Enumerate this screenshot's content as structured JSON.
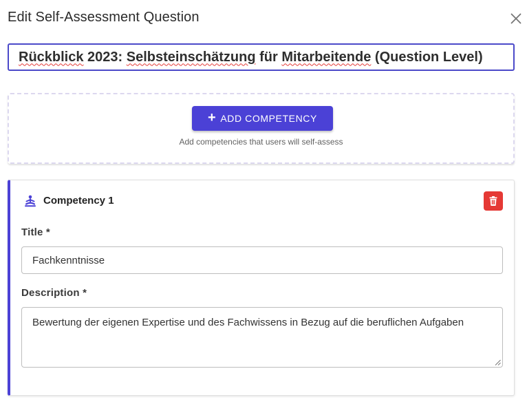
{
  "dialog": {
    "title": "Edit Self-Assessment Question",
    "close_icon": "close-icon"
  },
  "question": {
    "value_parts": [
      "Rückblick",
      " 2023: ",
      "Selbsteinschätzung",
      " für ",
      "Mitarbeitende",
      " (Question Level)"
    ]
  },
  "add_zone": {
    "button_label": "ADD COMPETENCY",
    "hint": "Add competencies that users will self-assess"
  },
  "competency": {
    "heading": "Competency 1",
    "icon": "person-meditation-icon",
    "delete_icon": "trash-icon",
    "title_label": "Title *",
    "title_value": "Fachkenntnisse",
    "description_label": "Description *",
    "description_value": "Bewertung der eigenen Expertise und des Fachwissens in Bezug auf die beruflichen Aufgaben"
  },
  "colors": {
    "accent": "#4b41d6",
    "danger": "#e53935"
  }
}
